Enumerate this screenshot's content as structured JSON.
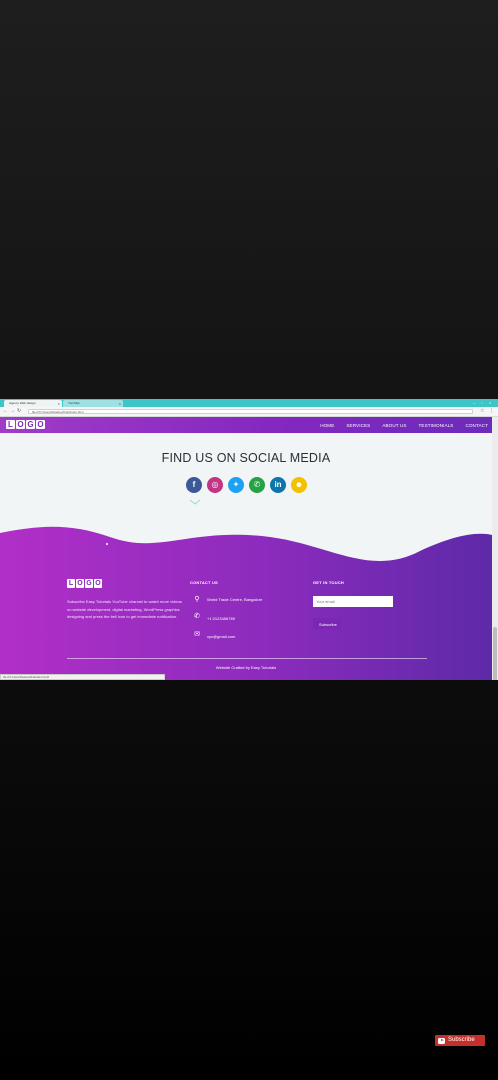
{
  "browser": {
    "tabs": [
      {
        "label": "Agency Web design",
        "active": true
      },
      {
        "label": "YouTube",
        "active": false
      }
    ],
    "url": "file:///C:/Users/Desktop/final/index.html"
  },
  "site": {
    "logo_letters": [
      "L",
      "O",
      "G",
      "O"
    ],
    "menu": [
      "HOME",
      "SERVICES",
      "ABOUT US",
      "TESTIMONIALS",
      "CONTACT"
    ],
    "social_title": "FIND US ON SOCIAL MEDIA",
    "social_icons": [
      {
        "name": "facebook-icon",
        "glyph": "f",
        "color": "#3b5998"
      },
      {
        "name": "instagram-icon",
        "glyph": "◎",
        "color": "#c13584"
      },
      {
        "name": "twitter-icon",
        "glyph": "✦",
        "color": "#1da1f2"
      },
      {
        "name": "whatsapp-icon",
        "glyph": "✆",
        "color": "#25a244"
      },
      {
        "name": "linkedin-icon",
        "glyph": "in",
        "color": "#0e76a8"
      },
      {
        "name": "snapchat-icon",
        "glyph": "☻",
        "color": "#f2c200"
      }
    ],
    "footer": {
      "about_text": "Subscribe Easy Tutorials YouTube channel to watch more videos on website development, digital marketing, WordPress graphics designing and press the bell icon to get immediate notification.",
      "contact_heading": "CONTACT US",
      "contact_items": [
        {
          "icon": "map-marker-icon",
          "text": "World Trade Centre, Bangalore"
        },
        {
          "icon": "phone-icon",
          "text": "+1 0123456789"
        },
        {
          "icon": "envelope-icon",
          "text": "xyz@gmail.com"
        }
      ],
      "touch_heading": "GET IN TOUCH",
      "email_placeholder": "Your email",
      "subscribe_label": "Subscribe",
      "credit": "Website Crafted by Easy Tutorials"
    }
  },
  "status_bar_url": "file:///C:/Users/Desktop/final/index.html#",
  "youtube_subscribe_label": "Subscribe",
  "colors": {
    "purple_start": "#b12fc8",
    "purple_end": "#5d2aa8"
  }
}
